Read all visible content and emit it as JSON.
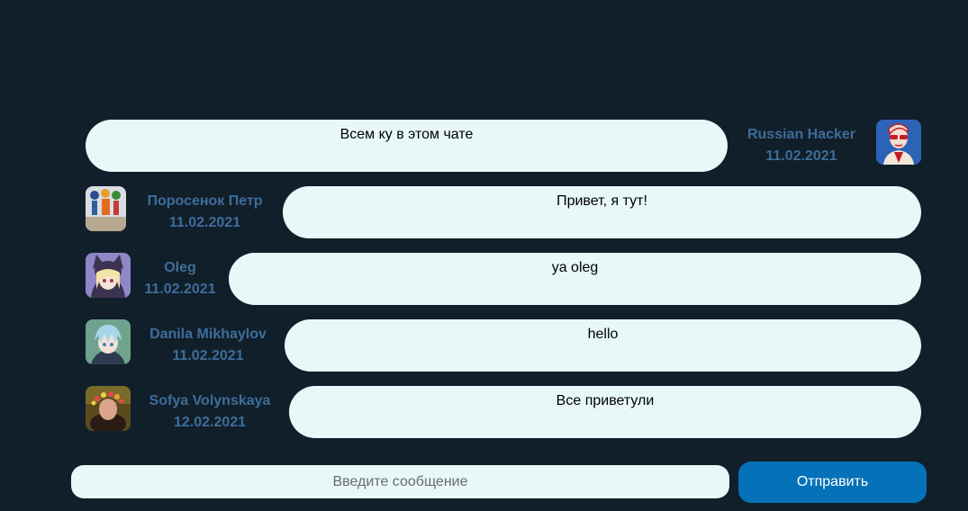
{
  "messages": [
    {
      "author": "Russian Hacker",
      "date": "11.02.2021",
      "text": "Всем ку в этом чате",
      "avatar_icon": "red-sunglasses-man-avatar"
    },
    {
      "author": "Поросенок Петр",
      "date": "11.02.2021",
      "text": "Привет, я тут!",
      "avatar_icon": "figurines-photo-avatar"
    },
    {
      "author": "Oleg",
      "date": "11.02.2021",
      "text": "ya oleg",
      "avatar_icon": "anime-cat-girl-avatar"
    },
    {
      "author": "Danila Mikhaylov",
      "date": "11.02.2021",
      "text": "hello",
      "avatar_icon": "anime-blue-hair-avatar"
    },
    {
      "author": "Sofya Volynskaya",
      "date": "12.02.2021",
      "text": "Все приветули",
      "avatar_icon": "flower-wreath-girl-avatar"
    }
  ],
  "composer": {
    "placeholder": "Введите сообщение",
    "value": "",
    "send_label": "Отправить"
  },
  "colors": {
    "background": "#111f2a",
    "bubble": "#e8f8f9",
    "author_text": "#3d6d9a",
    "send_button": "#0571b8"
  }
}
